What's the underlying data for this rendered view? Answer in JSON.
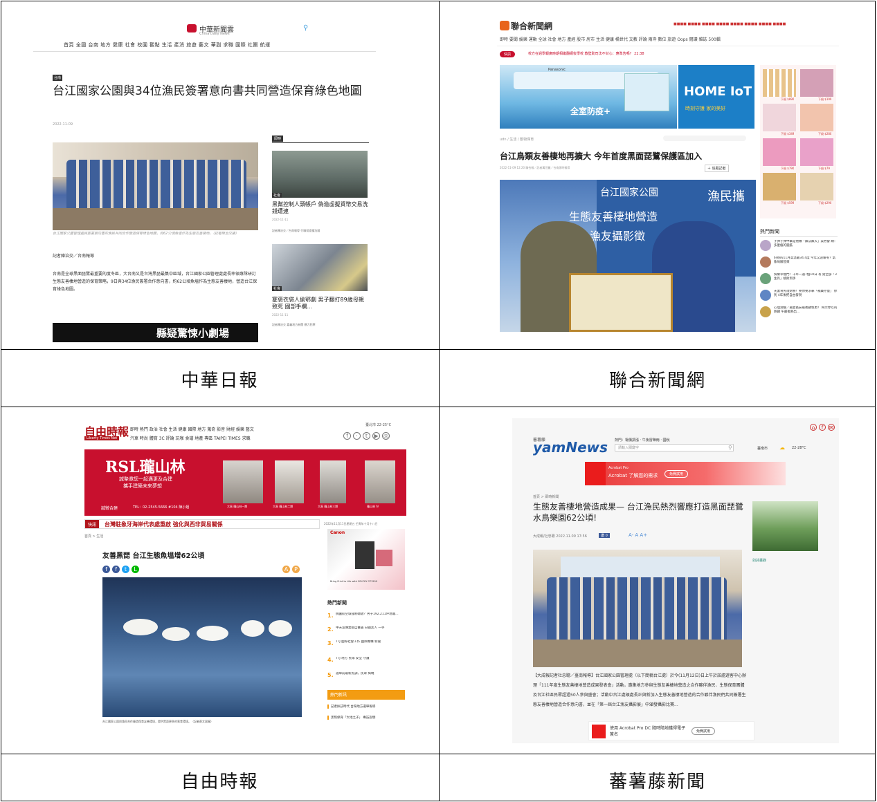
{
  "captions": [
    "中華日報",
    "聯合新聞網",
    "自由時報",
    "蕃薯藤新聞"
  ],
  "p1": {
    "logo": "中華新聞雲",
    "logo_sub": "China Daily News",
    "nav": "首頁 全國 台南 地方 健康 社會 校園 觀點 生活 產消 旅遊 藝文 華副 求職 國際 社團 航運",
    "tag": "台南",
    "headline": "台江國家公園與34位漁民簽署意向書共同營造保育綠色地圖",
    "date": "2022-11-09",
    "photo_caption": "台江國家公園管理處與簽署意向書的漁民共同合作營造保育綠色地圖，約62公頃魚塭作為生態友善棲地。（記者陳治交攝）",
    "byline": "記者陳治交／台南報導",
    "body": "台南是全球黑面琵鷺最重要的度冬區，大台南又是台灣黑琵最集中區域，台江國家公園管理處處長率領專隊研訂生態友善棲地營造的保育策略，9日與34位漁民簽署合作意向書，約62公頃魚塭作為生態友善棲地，營造台江保育綠色地圖。",
    "side_label": "即時",
    "side1_tag": "社會",
    "side1_title": "黑幫控制人頭帳戶 偽造虛擬資幣交易洗錢遭逮",
    "side1_date": "2022-11-11",
    "side1_by": "記者陳治交／台南報導 竹聯幫查獲洗錢",
    "side2_tag": "社會",
    "side2_title": "蹇褒衣袋人偷鄂劇 男子翻打89歲母親致死 國部手欄...",
    "side2_date": "2022-11-11",
    "side2_by": "記者陳治交 嘉義地方新聞 暴力犯罪",
    "banner": "縣疑驚悚小劇場"
  },
  "p2": {
    "logo": "聯合新聞網",
    "nav": "即時 要聞 娛樂 運動 全球 社會 地方 產經 股市 房市 生活 健康 橘世代 文教 評論 兩岸 數位 旅遊 Oops 閱讀 雜誌 500輯",
    "breaking_tag": "快訊",
    "breaking": "校方在週學報廣時期相繼翻網後學校 教壁助司法不甘心：應準告嗎？ 22:38",
    "ad_brand": "Panasonic",
    "ad_left": "全室防疫+",
    "ad_right_title": "HOME IoT",
    "ad_right_sub": "時刻守護 家的美好",
    "breadcrumb": "udn / 生活 / 動物保育",
    "headline": "台江鳥類友善棲地再擴大 今年首度黑面琵鷺保護區加入",
    "date": "2022-11-09 12:20 聯合報／記者萬世麗／台南即時報導",
    "follow": "＋ 追蹤記者",
    "photo_sign": "台江國家公園",
    "photo_text": "生態友善棲地營造",
    "photo_text2": "漁友攝影徵",
    "photo_right": "漁民攜",
    "hot_title": "熱門新聞",
    "hot": [
      "子彈子彈中撃是他做「無法無天」美勞會 網：多麼瘋的腦筋",
      "好熱的11月高溫破34.4度 今年又迎暖冬？氣象局解答來",
      "快樂幸福門！千年一遇7個10日 有 錯全部「3生肖」桃財到手",
      "夫妻育民證財務！要你要求罪「補藥存量」 你別 4年後把自由發現",
      "心理測驗／最愛長安最後顧色更？ 揭示你以的熱鑄 午最後熱出..."
    ],
    "prices": [
      "下殺 $890",
      "下殺 $199",
      "下殺 $349",
      "下殺 $280",
      "下殺 $790",
      "下殺 $79",
      "下殺 $599",
      "下殺 $290"
    ]
  },
  "p3": {
    "logo": "自由時報",
    "logo_sub": "Liberty Times Net",
    "nav1": "即時 熱門 政治 社會 生活 健康 國際 地方 蒐奇 影音 財經 娛樂 藝文",
    "nav2": "汽車 時尚 體育 3C 評論 玩咖 食譜 地產 專區 TAIPEI TIMES 求職",
    "weather": "臺北市 22-25°C",
    "ad_title": "RSL瓏山林",
    "ad_sub": "誠摯邀您一起邁更及合建",
    "ad_sub2": "攜手建築未來夢想",
    "ad_contact": "TEL：02-2545-5666 #104 陳小姐",
    "ad_join": "誠徵合建",
    "ad_labels": [
      "大直 瓏山林一期",
      "大直 瓏山林二期",
      "大直 瓏山林三期",
      "瓏山林 IV"
    ],
    "breaking_tag": "快訊",
    "breaking": "台灣駐象牙海岸代表處重啟 強化與西非貿易關係",
    "sidedate": "2022年11月11日星期五 壬寅年十月十八日",
    "breadcrumb": "首頁 > 生活",
    "headline": "友善黑琵 台江生態魚塭增62公頃",
    "photo_caption": "台江國家公園與漁民合作營造保育友善環境，提供黑琵更多的覓食環境。（記者蔡文居攝）",
    "canon": "Canon",
    "ad_side_text": "Bring Print to Life with SELPHY CP1500",
    "hot_title": "熱門新聞",
    "hot": [
      "桃園航空城強制徵收？男子192.211坪地遭…",
      "中天宣傳業擅自審查 分鐘黑人 一手 ",
      "TTJ 國際社會工作 國際機構 新聞",
      "TTJ 地方 民眾 安全 守護",
      "選舉前最新民調，民眾 揭曉"
    ],
    "news_title": "熱門新訊",
    "news": [
      "記者採訪時代 台灣地方選舉報導",
      "黑熊保育「大地之子」 專訪說明"
    ]
  },
  "p4": {
    "logo_small": "蕃薯藤",
    "logo": "yamNews",
    "nav": "熱門：電價調漲 ‧ 午後雷陣雨 ‧ 國稅",
    "search_placeholder": "請輸入關鍵字",
    "city": "臺南市",
    "temp": "22-28°C",
    "ad_title": "Acrobat Pro",
    "ad_text": "Acrobat 了解您的需求",
    "ad_btn": "免費試用",
    "breadcrumb": "首頁 > 即時新聞",
    "headline": "生態友善棲地營造成果— 台江漁民熱烈響應打造黑面琵鷺水鳥樂園62公頃!",
    "byline": "大成報/社忠聰 2022.11.09 17:56",
    "font_ctrl": "A- A A+",
    "side_label": "如詩畫錄",
    "body": "【大成報記者杜忠聰／臺南報導】台江國家公園管理處（以下簡稱台江處）於今(11月12日)日上午於該處遊客中心辦理「111年度生態友善棲地營造成果發表會」活動，邀集地方參與生態友善棲地營造之合作夥伴漁民、生態保育團體及台江社區民眾超過50人參與盛會；活動中台江處頒處長正與新加入生態友善棲地營造的合作夥伴漁民們共同簽署生態友善棲地營造合作意向書，並在「第一屆台江漁友攝影展」中頒發攝影比賽...",
    "bottom_ad": "使用 Acrobat Pro DC 隨時隨地獲得電子簽名",
    "bottom_btn": "免費試用"
  }
}
